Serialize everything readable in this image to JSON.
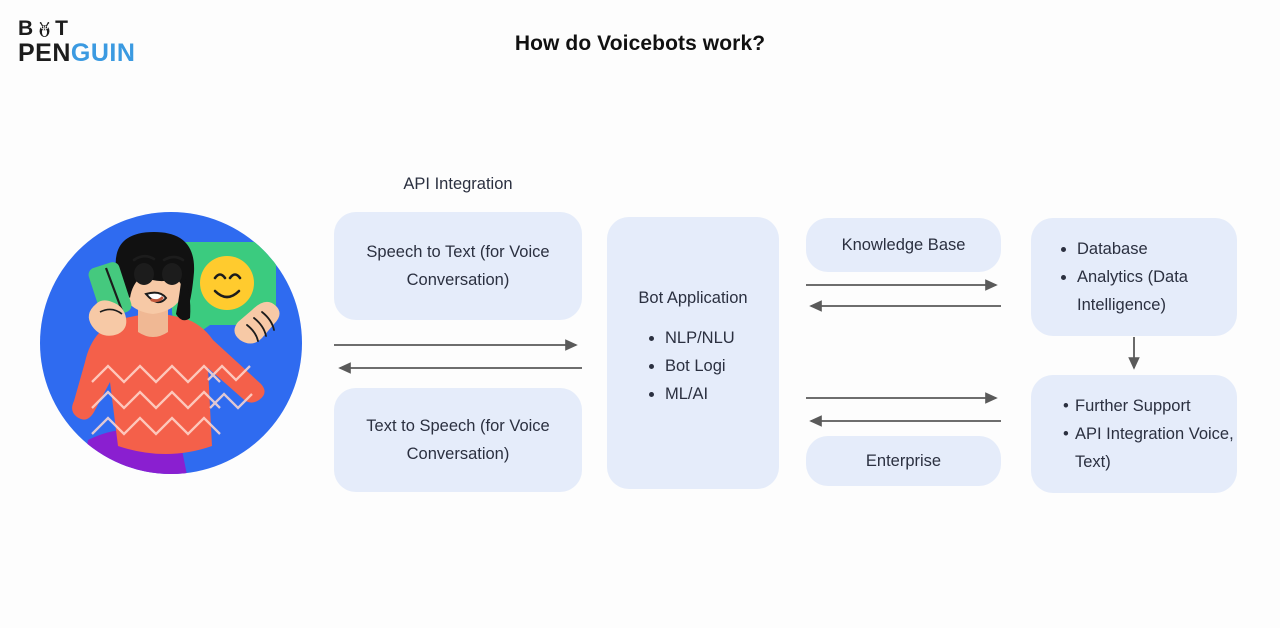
{
  "brand": {
    "logo_line1_prefix": "B",
    "logo_line1_suffix": "T",
    "logo_line2_dark": "PEN",
    "logo_line2_accent": "GUIN",
    "accent_color": "#3b9ae1",
    "dark_color": "#1c1c1c",
    "mark_name": "penguin-icon"
  },
  "header": {
    "title": "How do Voicebots work?"
  },
  "illustration": {
    "name": "woman-on-phone-illustration",
    "circle_color": "#2f6bf0",
    "bubble_color": "#3bcb7f",
    "emoji_color": "#ffcb2e",
    "sweater_color": "#f4604a",
    "skirt_color": "#8a1fd0",
    "hair_color": "#111111",
    "skin_color": "#f7c9a6",
    "phone_color": "#45c97e"
  },
  "flow": {
    "api_label": "API Integration",
    "speech_to_text": "Speech to Text (for Voice Conversation)",
    "text_to_speech": "Text to Speech (for Voice Conversation)",
    "bot_title": "Bot Application",
    "bot_items": [
      "NLP/NLU",
      "Bot Logi",
      "ML/AI"
    ],
    "knowledge_base": "Knowledge Base",
    "enterprise": "Enterprise",
    "data_items": [
      "Database",
      "Analytics (Data Intelligence)"
    ],
    "support_items": [
      "Further Support",
      "API Integration Voice, Text)"
    ],
    "box_fill": "#e5ecfa",
    "arrow_color": "#5a5a5a",
    "text_color": "#2b3040"
  },
  "arrows": [
    {
      "name": "arrow-illustration-to-stt",
      "direction": "right"
    },
    {
      "name": "arrow-tts-to-illustration",
      "direction": "left"
    },
    {
      "name": "arrow-bot-to-knowledge-base",
      "direction": "right"
    },
    {
      "name": "arrow-knowledge-base-to-bot",
      "direction": "left"
    },
    {
      "name": "arrow-bot-to-enterprise",
      "direction": "right"
    },
    {
      "name": "arrow-enterprise-to-bot",
      "direction": "left"
    },
    {
      "name": "arrow-data-to-support",
      "direction": "down"
    }
  ]
}
